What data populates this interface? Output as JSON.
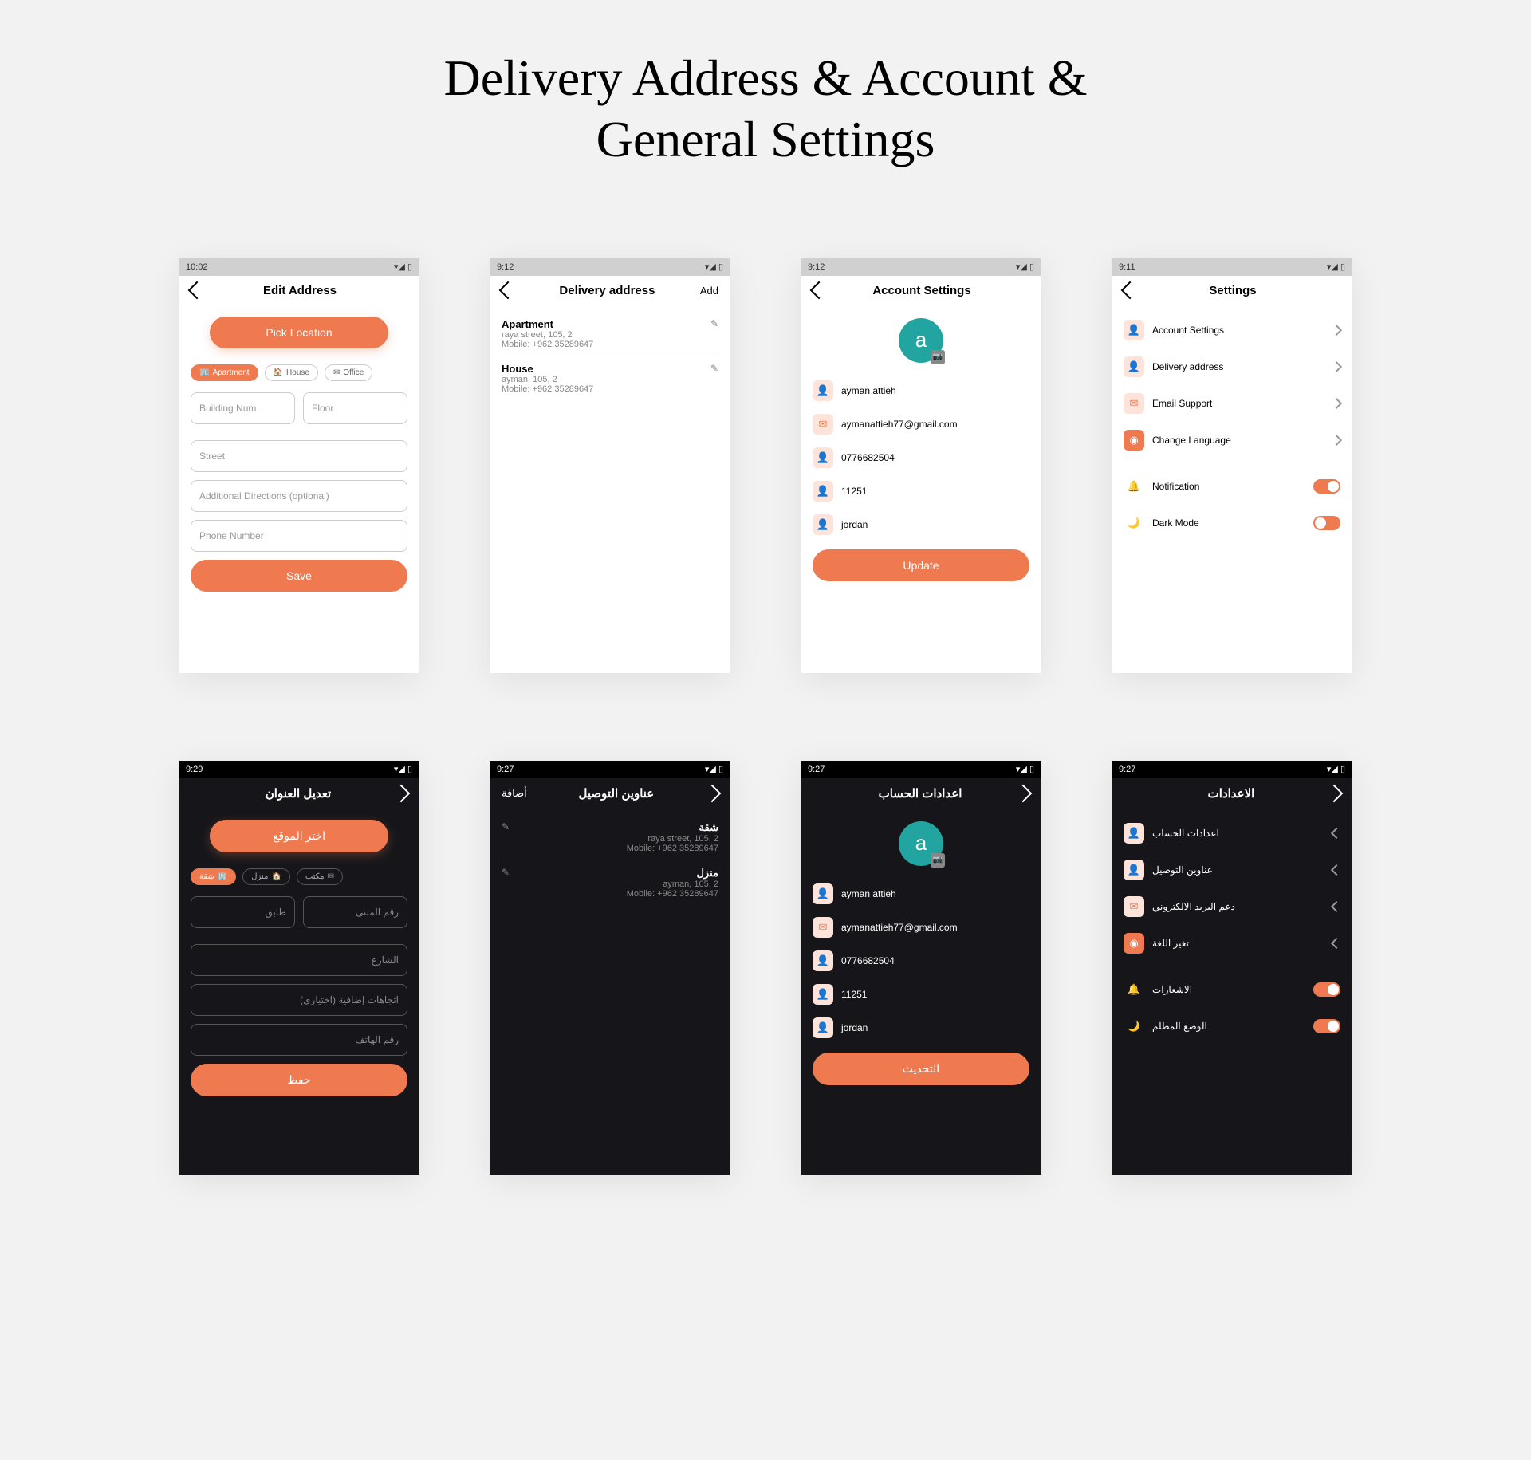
{
  "page_title_line1": "Delivery Address & Account &",
  "page_title_line2": "General Settings",
  "status": {
    "t1": "10:02",
    "t2": "9:12",
    "t3": "9:12",
    "t4": "9:11",
    "t5": "9:29",
    "t6": "9:27",
    "t7": "9:27",
    "t8": "9:27"
  },
  "s1": {
    "title": "Edit Address",
    "pick": "Pick Location",
    "chip_apt": "Apartment",
    "chip_house": "House",
    "chip_office": "Office",
    "building": "Building Num",
    "floor": "Floor",
    "street": "Street",
    "directions": "Additional Directions (optional)",
    "phone": "Phone Number",
    "save": "Save"
  },
  "s2": {
    "title": "Delivery address",
    "add": "Add",
    "a1": {
      "name": "Apartment",
      "l1": "raya street, 105, 2",
      "l2": "Mobile:  +962 35289647"
    },
    "a2": {
      "name": "House",
      "l1": "ayman, 105, 2",
      "l2": "Mobile:  +962 35289647"
    }
  },
  "s3": {
    "title": "Account Settings",
    "avatar": "a",
    "name": "ayman attieh",
    "email": "aymanattieh77@gmail.com",
    "phone": "0776682504",
    "zip": "11251",
    "country": "jordan",
    "update": "Update"
  },
  "s4": {
    "title": "Settings",
    "r1": "Account Settings",
    "r2": "Delivery address",
    "r3": "Email Support",
    "r4": "Change Language",
    "r5": "Notification",
    "r6": "Dark Mode"
  },
  "s5": {
    "title": "تعديل العنوان",
    "pick": "اختر الموقع",
    "chip_apt": "شقة",
    "chip_house": "منزل",
    "chip_office": "مكتب",
    "building": "رقم المبنى",
    "floor": "طابق",
    "street": "الشارع",
    "directions": "اتجاهات إضافية (اختياري)",
    "phone": "رقم الهاتف",
    "save": "حفظ"
  },
  "s6": {
    "title": "عناوين التوصيل",
    "add": "أضافة",
    "a1": {
      "name": "شقة",
      "l1": "raya street, 105, 2",
      "l2": "Mobile: +962 35289647"
    },
    "a2": {
      "name": "منزل",
      "l1": "ayman, 105, 2",
      "l2": "Mobile: +962 35289647"
    }
  },
  "s7": {
    "title": "اعدادات الحساب",
    "avatar": "a",
    "name": "ayman attieh",
    "email": "aymanattieh77@gmail.com",
    "phone": "0776682504",
    "zip": "11251",
    "country": "jordan",
    "update": "التحديث"
  },
  "s8": {
    "title": "الاعدادات",
    "r1": "اعدادات الحساب",
    "r2": "عناوين التوصيل",
    "r3": "دعم البريد الالكتروني",
    "r4": "تغير اللغة",
    "r5": "الاشعارات",
    "r6": "الوضع المظلم"
  }
}
